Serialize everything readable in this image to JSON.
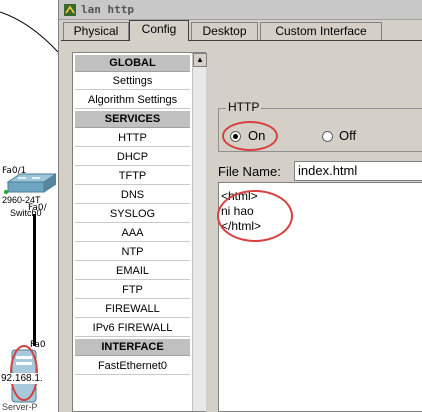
{
  "window": {
    "title": "lan http",
    "accent_color": "#d64040"
  },
  "tabs": [
    {
      "label": "Physical"
    },
    {
      "label": "Config"
    },
    {
      "label": "Desktop"
    },
    {
      "label": "Custom Interface"
    }
  ],
  "sidebar": {
    "global_header": "GLOBAL",
    "global_items": [
      {
        "label": "Settings"
      },
      {
        "label": "Algorithm Settings"
      }
    ],
    "services_header": "SERVICES",
    "services_items": [
      {
        "label": "HTTP"
      },
      {
        "label": "DHCP"
      },
      {
        "label": "TFTP"
      },
      {
        "label": "DNS"
      },
      {
        "label": "SYSLOG"
      },
      {
        "label": "AAA"
      },
      {
        "label": "NTP"
      },
      {
        "label": "EMAIL"
      },
      {
        "label": "FTP"
      },
      {
        "label": "FIREWALL"
      },
      {
        "label": "IPv6 FIREWALL"
      }
    ],
    "interface_header": "INTERFACE",
    "interface_items": [
      {
        "label": "FastEthernet0"
      }
    ]
  },
  "http": {
    "group_label": "HTTP",
    "on_label": "On",
    "off_label": "Off",
    "selected": "On"
  },
  "file": {
    "name_label": "File Name:",
    "name_value": "index.html",
    "content_lines": [
      "<html>",
      "ni hao",
      "</html>"
    ]
  },
  "topology": {
    "switch_port": "Fa0/1",
    "switch_model": "2960-24T",
    "switch_name": "Switch0",
    "switch_port2": "Fa0/",
    "server_port": "Fa0",
    "server_ip": "92.168.1.",
    "server_name": "Server-P"
  }
}
